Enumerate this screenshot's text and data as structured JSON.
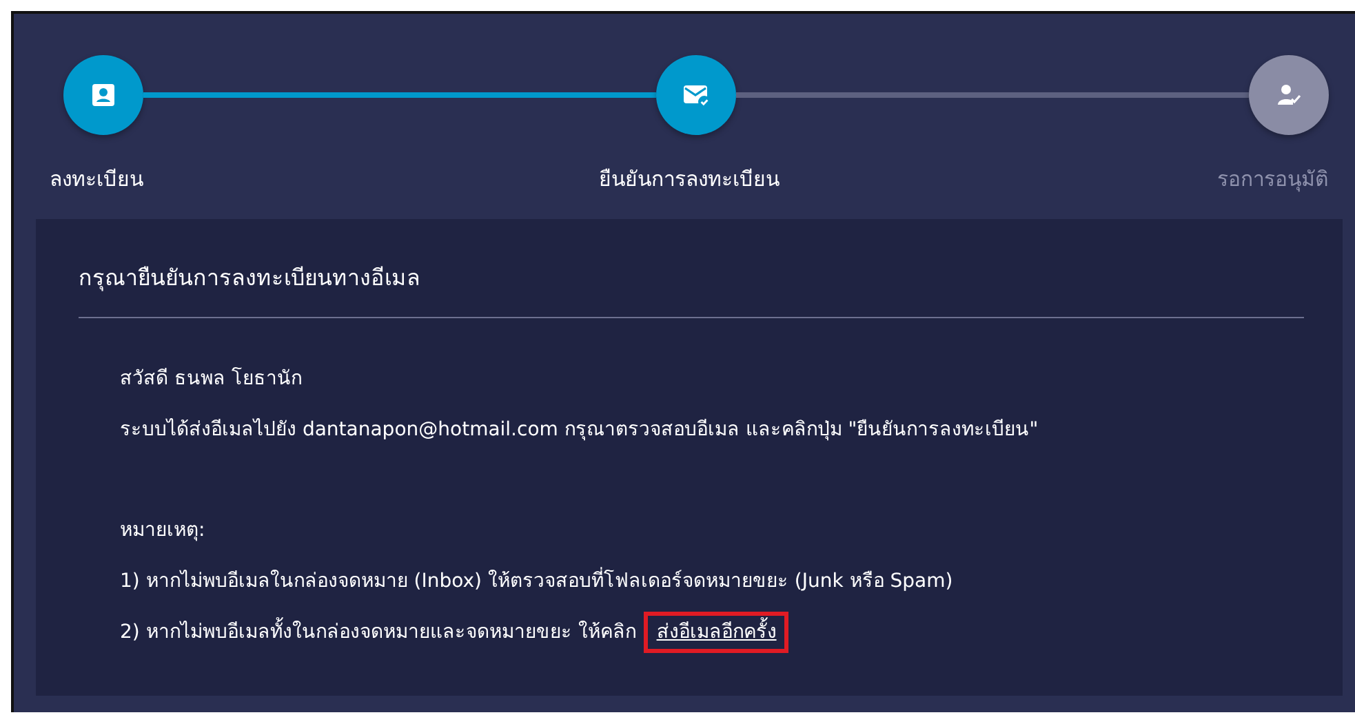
{
  "steps": [
    {
      "label": "ลงทะเบียน",
      "kind": "profile",
      "completed": true
    },
    {
      "label": "ยืนยันการลงทะเบียน",
      "kind": "mail",
      "completed": true
    },
    {
      "label": "รอการอนุมัติ",
      "kind": "approval",
      "completed": false
    }
  ],
  "card": {
    "title": "กรุณายืนยันการลงทะเบียนทางอีเมล",
    "greeting": "สวัสดี ธนพล โยธานัก",
    "message": "ระบบได้ส่งอีเมลไปยัง dantanapon@hotmail.com กรุณาตรวจสอบอีเมล และคลิกปุ่ม \"ยืนยันการลงทะเบียน\"",
    "note_title": "หมายเหตุ:",
    "note_1": "1) หากไม่พบอีเมลในกล่องจดหมาย (Inbox) ให้ตรวจสอบที่โฟลเดอร์จดหมายขยะ (Junk หรือ Spam)",
    "note_2": "2) หากไม่พบอีเมลทั้งในกล่องจดหมายและจดหมายขยะ ให้คลิก",
    "resend_link": {
      "label": "ส่งอีเมลอีกครั้ง",
      "highlighted": true
    }
  }
}
